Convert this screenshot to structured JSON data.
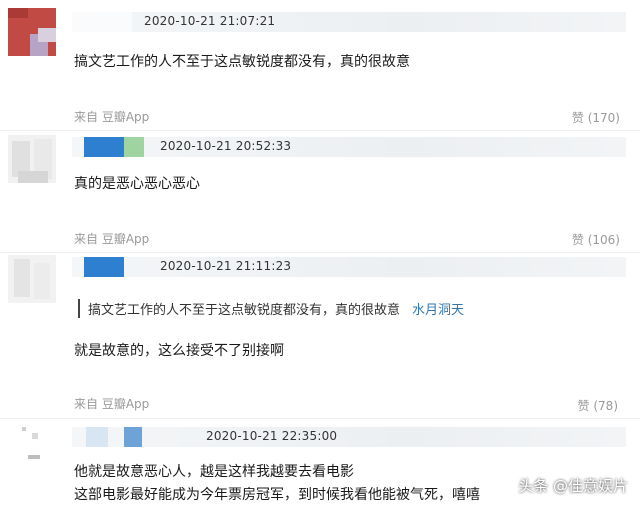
{
  "comments": [
    {
      "timestamp": "2020-10-21 21:07:21",
      "text": "搞文艺工作的人不至于这点敏锐度都没有，真的很故意",
      "source": "来自 豆瓣App",
      "likes": "赞 (170)"
    },
    {
      "timestamp": "2020-10-21 20:52:33",
      "text": "真的是恶心恶心恶心",
      "source": "来自 豆瓣App",
      "likes": "赞 (106)"
    },
    {
      "timestamp": "2020-10-21 21:11:23",
      "quote": {
        "text": "搞文艺工作的人不至于这点敏锐度都没有，真的很故意",
        "author": "水月洞天"
      },
      "text": "就是故意的，这么接受不了别接啊",
      "source": "来自 豆瓣App",
      "likes": "赞 (78)"
    },
    {
      "timestamp": "2020-10-21 22:35:00",
      "text_lines": [
        "他就是故意恶心人，越是这样我越要去看电影",
        "这部电影最好能成为今年票房冠军，到时候我看他能被气死，嘻嘻"
      ]
    }
  ],
  "watermark": "头条 @佳意娱片",
  "colors": {
    "meta_gray": "#9a9a9a",
    "quote_name_blue": "#3377aa",
    "header_bar": "#eceff2"
  }
}
